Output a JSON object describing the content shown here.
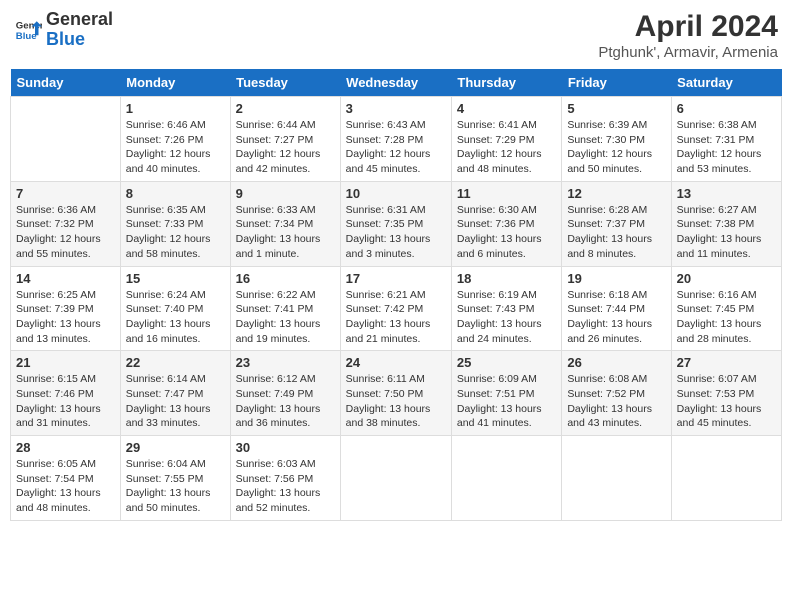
{
  "header": {
    "logo_line1": "General",
    "logo_line2": "Blue",
    "title": "April 2024",
    "subtitle": "Ptghunk', Armavir, Armenia"
  },
  "days_of_week": [
    "Sunday",
    "Monday",
    "Tuesday",
    "Wednesday",
    "Thursday",
    "Friday",
    "Saturday"
  ],
  "weeks": [
    [
      {
        "day": "",
        "content": ""
      },
      {
        "day": "1",
        "content": "Sunrise: 6:46 AM\nSunset: 7:26 PM\nDaylight: 12 hours\nand 40 minutes."
      },
      {
        "day": "2",
        "content": "Sunrise: 6:44 AM\nSunset: 7:27 PM\nDaylight: 12 hours\nand 42 minutes."
      },
      {
        "day": "3",
        "content": "Sunrise: 6:43 AM\nSunset: 7:28 PM\nDaylight: 12 hours\nand 45 minutes."
      },
      {
        "day": "4",
        "content": "Sunrise: 6:41 AM\nSunset: 7:29 PM\nDaylight: 12 hours\nand 48 minutes."
      },
      {
        "day": "5",
        "content": "Sunrise: 6:39 AM\nSunset: 7:30 PM\nDaylight: 12 hours\nand 50 minutes."
      },
      {
        "day": "6",
        "content": "Sunrise: 6:38 AM\nSunset: 7:31 PM\nDaylight: 12 hours\nand 53 minutes."
      }
    ],
    [
      {
        "day": "7",
        "content": "Sunrise: 6:36 AM\nSunset: 7:32 PM\nDaylight: 12 hours\nand 55 minutes."
      },
      {
        "day": "8",
        "content": "Sunrise: 6:35 AM\nSunset: 7:33 PM\nDaylight: 12 hours\nand 58 minutes."
      },
      {
        "day": "9",
        "content": "Sunrise: 6:33 AM\nSunset: 7:34 PM\nDaylight: 13 hours\nand 1 minute."
      },
      {
        "day": "10",
        "content": "Sunrise: 6:31 AM\nSunset: 7:35 PM\nDaylight: 13 hours\nand 3 minutes."
      },
      {
        "day": "11",
        "content": "Sunrise: 6:30 AM\nSunset: 7:36 PM\nDaylight: 13 hours\nand 6 minutes."
      },
      {
        "day": "12",
        "content": "Sunrise: 6:28 AM\nSunset: 7:37 PM\nDaylight: 13 hours\nand 8 minutes."
      },
      {
        "day": "13",
        "content": "Sunrise: 6:27 AM\nSunset: 7:38 PM\nDaylight: 13 hours\nand 11 minutes."
      }
    ],
    [
      {
        "day": "14",
        "content": "Sunrise: 6:25 AM\nSunset: 7:39 PM\nDaylight: 13 hours\nand 13 minutes."
      },
      {
        "day": "15",
        "content": "Sunrise: 6:24 AM\nSunset: 7:40 PM\nDaylight: 13 hours\nand 16 minutes."
      },
      {
        "day": "16",
        "content": "Sunrise: 6:22 AM\nSunset: 7:41 PM\nDaylight: 13 hours\nand 19 minutes."
      },
      {
        "day": "17",
        "content": "Sunrise: 6:21 AM\nSunset: 7:42 PM\nDaylight: 13 hours\nand 21 minutes."
      },
      {
        "day": "18",
        "content": "Sunrise: 6:19 AM\nSunset: 7:43 PM\nDaylight: 13 hours\nand 24 minutes."
      },
      {
        "day": "19",
        "content": "Sunrise: 6:18 AM\nSunset: 7:44 PM\nDaylight: 13 hours\nand 26 minutes."
      },
      {
        "day": "20",
        "content": "Sunrise: 6:16 AM\nSunset: 7:45 PM\nDaylight: 13 hours\nand 28 minutes."
      }
    ],
    [
      {
        "day": "21",
        "content": "Sunrise: 6:15 AM\nSunset: 7:46 PM\nDaylight: 13 hours\nand 31 minutes."
      },
      {
        "day": "22",
        "content": "Sunrise: 6:14 AM\nSunset: 7:47 PM\nDaylight: 13 hours\nand 33 minutes."
      },
      {
        "day": "23",
        "content": "Sunrise: 6:12 AM\nSunset: 7:49 PM\nDaylight: 13 hours\nand 36 minutes."
      },
      {
        "day": "24",
        "content": "Sunrise: 6:11 AM\nSunset: 7:50 PM\nDaylight: 13 hours\nand 38 minutes."
      },
      {
        "day": "25",
        "content": "Sunrise: 6:09 AM\nSunset: 7:51 PM\nDaylight: 13 hours\nand 41 minutes."
      },
      {
        "day": "26",
        "content": "Sunrise: 6:08 AM\nSunset: 7:52 PM\nDaylight: 13 hours\nand 43 minutes."
      },
      {
        "day": "27",
        "content": "Sunrise: 6:07 AM\nSunset: 7:53 PM\nDaylight: 13 hours\nand 45 minutes."
      }
    ],
    [
      {
        "day": "28",
        "content": "Sunrise: 6:05 AM\nSunset: 7:54 PM\nDaylight: 13 hours\nand 48 minutes."
      },
      {
        "day": "29",
        "content": "Sunrise: 6:04 AM\nSunset: 7:55 PM\nDaylight: 13 hours\nand 50 minutes."
      },
      {
        "day": "30",
        "content": "Sunrise: 6:03 AM\nSunset: 7:56 PM\nDaylight: 13 hours\nand 52 minutes."
      },
      {
        "day": "",
        "content": ""
      },
      {
        "day": "",
        "content": ""
      },
      {
        "day": "",
        "content": ""
      },
      {
        "day": "",
        "content": ""
      }
    ]
  ]
}
